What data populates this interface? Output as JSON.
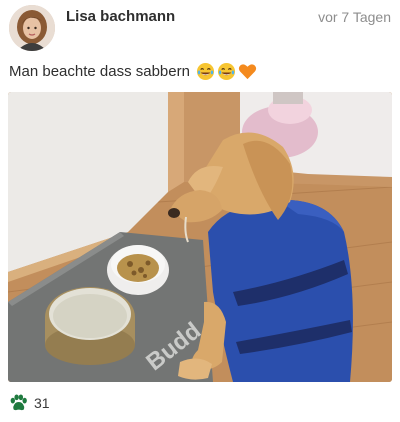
{
  "post": {
    "author": "Lisa bachmann",
    "timestamp": "vor 7 Tagen",
    "caption": "Man beachte dass sabbern",
    "caption_emojis": [
      "laughing-tears-emoji",
      "laughing-tears-emoji",
      "orange-heart-emoji"
    ],
    "photo_watermark": "Budd",
    "likes": {
      "icon": "paw-icon",
      "count": "31",
      "color": "#1f7a3f"
    }
  }
}
